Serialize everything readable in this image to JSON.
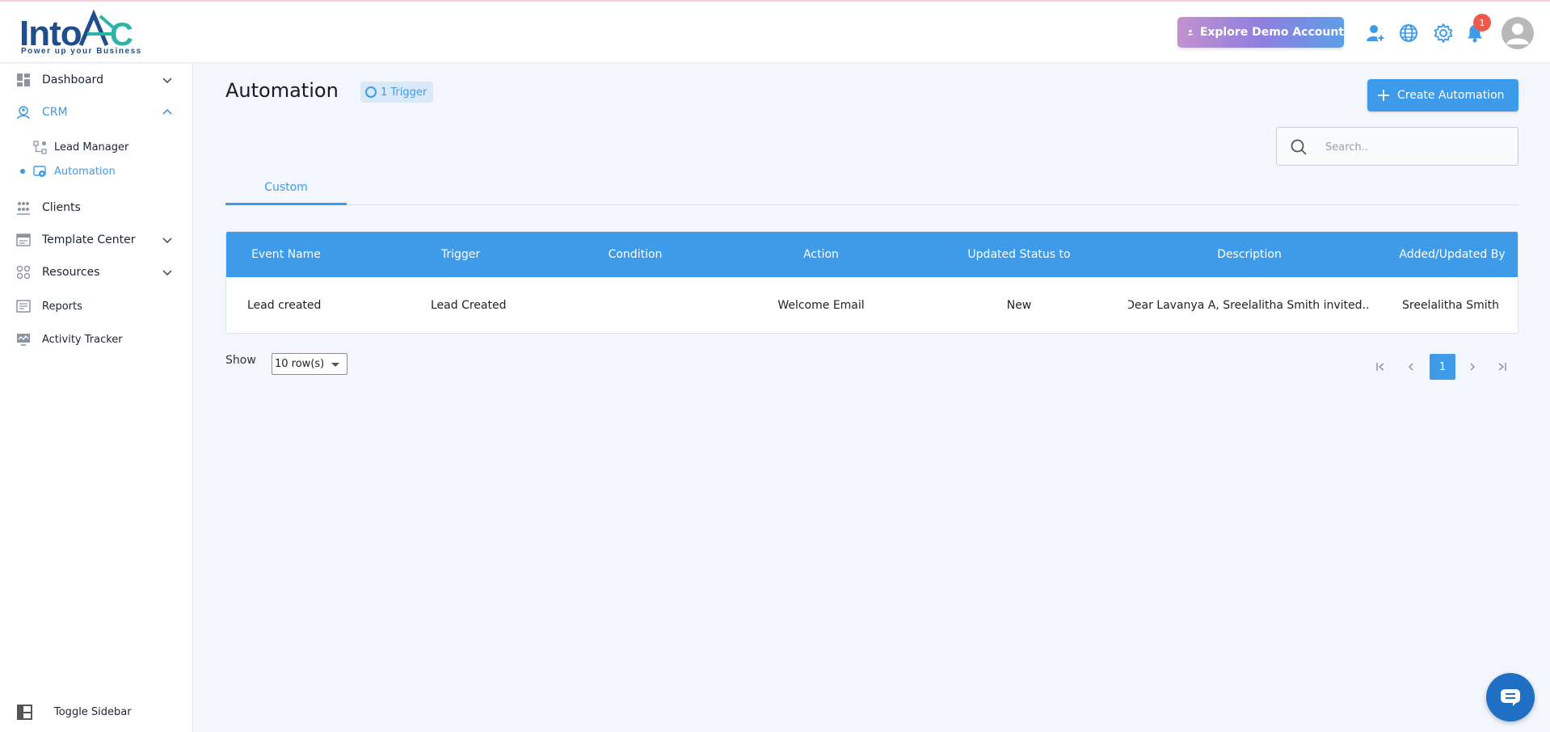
{
  "brand": {
    "logo_text": "IntoAEC",
    "tagline": "Power up your Business"
  },
  "header": {
    "demo_button": "Explore Demo Account",
    "notification_count": "1",
    "icons": [
      "add-user-icon",
      "globe-icon",
      "gear-icon",
      "bell-icon",
      "avatar"
    ]
  },
  "sidebar": {
    "items": [
      {
        "label": "Dashboard",
        "icon": "dashboard-icon",
        "expandable": true
      },
      {
        "label": "CRM",
        "icon": "crm-icon",
        "expandable": true,
        "expanded": true,
        "active": true
      },
      {
        "label": "Clients",
        "icon": "clients-icon"
      },
      {
        "label": "Template Center",
        "icon": "template-icon",
        "expandable": true
      },
      {
        "label": "Resources",
        "icon": "resources-icon",
        "expandable": true
      },
      {
        "label": "Reports",
        "icon": "reports-icon"
      },
      {
        "label": "Activity Tracker",
        "icon": "activity-icon"
      }
    ],
    "crm_sub": [
      {
        "label": "Lead Manager",
        "icon": "lead-manager-icon"
      },
      {
        "label": "Automation",
        "icon": "automation-icon",
        "active": true
      }
    ],
    "toggle_label": "Toggle Sidebar"
  },
  "page": {
    "title": "Automation",
    "trigger_chip": "1 Trigger",
    "create_button": "Create Automation",
    "search_placeholder": "Search..",
    "tabs": [
      {
        "label": "Custom",
        "active": true
      }
    ]
  },
  "table": {
    "columns": [
      "Event Name",
      "Trigger",
      "Condition",
      "Action",
      "Updated Status to",
      "Description",
      "Added/Updated By"
    ],
    "rows": [
      {
        "event_name": "Lead created",
        "trigger": "Lead Created",
        "condition": "",
        "action": "Welcome Email",
        "updated_status": "New",
        "description": "Dear Lavanya A, Sreelalitha Smith invited...",
        "added_by": "Sreelalitha Smith"
      }
    ]
  },
  "pagination": {
    "show_label": "Show",
    "rows_option": "10 row(s)",
    "current_page": "1"
  },
  "colors": {
    "accent": "#3d9be9",
    "background": "#f3f7fd",
    "badge": "#f05a4d"
  }
}
